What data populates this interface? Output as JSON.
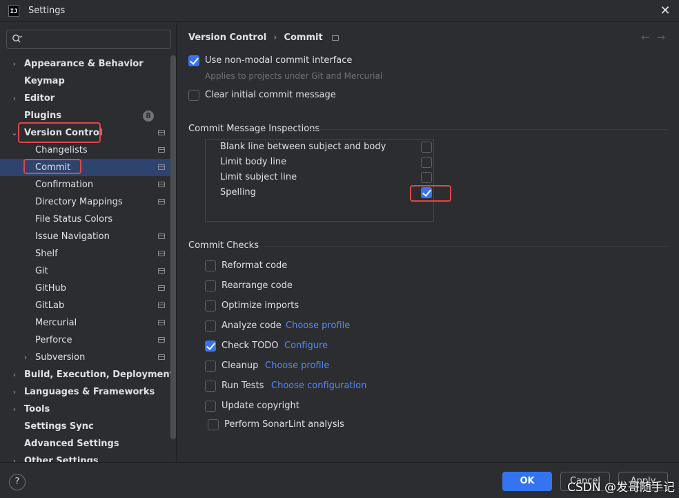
{
  "window": {
    "logo_text": "IJ",
    "title": "Settings",
    "close_glyph": "✕"
  },
  "search": {
    "value": "",
    "placeholder": ""
  },
  "tree": {
    "items": [
      {
        "label": "Appearance & Behavior",
        "bold": true,
        "chev": "›"
      },
      {
        "label": "Keymap",
        "bold": true
      },
      {
        "label": "Editor",
        "bold": true,
        "chev": "›"
      },
      {
        "label": "Plugins",
        "bold": true,
        "badge": "8"
      },
      {
        "label": "Version Control",
        "bold": true,
        "chev": "⌄"
      },
      {
        "label": "Changelists"
      },
      {
        "label": "Commit"
      },
      {
        "label": "Confirmation"
      },
      {
        "label": "Directory Mappings"
      },
      {
        "label": "File Status Colors"
      },
      {
        "label": "Issue Navigation"
      },
      {
        "label": "Shelf"
      },
      {
        "label": "Git"
      },
      {
        "label": "GitHub"
      },
      {
        "label": "GitLab"
      },
      {
        "label": "Mercurial"
      },
      {
        "label": "Perforce"
      },
      {
        "label": "Subversion",
        "chev": "›"
      },
      {
        "label": "Build, Execution, Deployment",
        "bold": true,
        "chev": "›"
      },
      {
        "label": "Languages & Frameworks",
        "bold": true,
        "chev": "›"
      },
      {
        "label": "Tools",
        "bold": true,
        "chev": "›"
      },
      {
        "label": "Settings Sync",
        "bold": true
      },
      {
        "label": "Advanced Settings",
        "bold": true
      },
      {
        "label": "Other Settings",
        "bold": true,
        "chev": "›"
      }
    ]
  },
  "breadcrumb": {
    "parent": "Version Control",
    "separator": "›",
    "current": "Commit"
  },
  "nav": {
    "back": "←",
    "forward": "→"
  },
  "general": {
    "non_modal": {
      "label": "Use non-modal commit interface",
      "checked": true
    },
    "non_modal_hint": "Applies to projects under Git and Mercurial",
    "clear_message": {
      "label": "Clear initial commit message",
      "checked": false
    }
  },
  "inspections": {
    "title": "Commit Message Inspections",
    "items": [
      {
        "label": "Blank line between subject and body",
        "checked": false
      },
      {
        "label": "Limit body line",
        "checked": false
      },
      {
        "label": "Limit subject line",
        "checked": false
      },
      {
        "label": "Spelling",
        "checked": true
      }
    ]
  },
  "checks": {
    "title": "Commit Checks",
    "items": [
      {
        "label": "Reformat code",
        "checked": false,
        "link": ""
      },
      {
        "label": "Rearrange code",
        "checked": false,
        "link": ""
      },
      {
        "label": "Optimize imports",
        "checked": false,
        "link": ""
      },
      {
        "label": "Analyze code",
        "checked": false,
        "link": "Choose profile"
      },
      {
        "label": "Check TODO",
        "checked": true,
        "link": "Configure"
      },
      {
        "label": "Cleanup",
        "checked": false,
        "link": "Choose profile"
      },
      {
        "label": "Run Tests",
        "checked": false,
        "link": "Choose configuration"
      },
      {
        "label": "Update copyright",
        "checked": false,
        "link": ""
      },
      {
        "label": "Perform SonarLint analysis",
        "checked": false,
        "link": ""
      }
    ]
  },
  "footer": {
    "help": "?",
    "ok": "OK",
    "cancel": "Cancel",
    "apply": "Apply"
  },
  "watermark": "CSDN @发哥随手记",
  "colors": {
    "background": "#2b2d30",
    "selection": "#2e436e",
    "accent": "#3574f0",
    "link": "#548af7",
    "highlight_box": "#e04848"
  }
}
